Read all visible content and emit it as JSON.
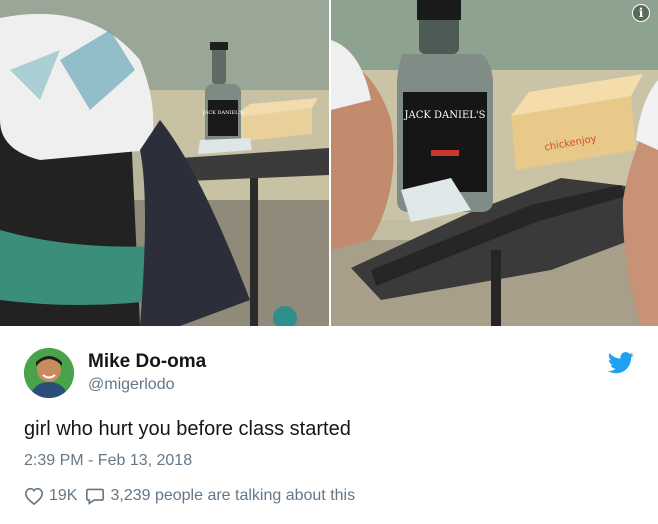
{
  "tweet": {
    "display_name": "Mike Do-oma",
    "handle": "@migerlodo",
    "text": "girl who hurt you before class started",
    "timestamp": "2:39 PM - Feb 13, 2018",
    "likes": "19K",
    "conversation": "3,239 people are talking about this"
  },
  "media": {
    "left_photo_bottle_label": "JACK DANIEL'S",
    "right_photo_bottle_label": "JACK DANIEL'S",
    "right_photo_box_text": "chickenjoy",
    "icon": "info-icon"
  },
  "colors": {
    "brand_blue": "#1da1f2",
    "secondary_text": "#657786",
    "primary_text": "#14171a"
  },
  "icons": [
    "info-icon",
    "twitter-bird-icon",
    "heart-icon",
    "reply-bubble-icon"
  ]
}
